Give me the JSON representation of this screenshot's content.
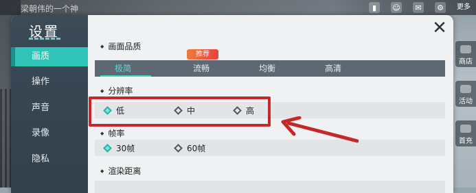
{
  "top_bar": {
    "title": "梁朝伟的一个神",
    "icons": [
      "chart-icon",
      "friends-icon",
      "mail-icon",
      "gear-icon"
    ],
    "more_label": "更多"
  },
  "right_menu": [
    "商店",
    "活动",
    "首充"
  ],
  "panel": {
    "title": "设置",
    "close_glyph": "✕",
    "sidebar": [
      {
        "label": "画质",
        "active": true
      },
      {
        "label": "操作",
        "active": false
      },
      {
        "label": "声音",
        "active": false
      },
      {
        "label": "录像",
        "active": false
      },
      {
        "label": "隐私",
        "active": false
      }
    ],
    "sections": {
      "quality": {
        "title": "画面品质",
        "badge": "推荐",
        "options": [
          {
            "label": "极简",
            "selected": true
          },
          {
            "label": "流畅",
            "selected": false
          },
          {
            "label": "均衡",
            "selected": false
          },
          {
            "label": "高清",
            "selected": false
          }
        ]
      },
      "resolution": {
        "title": "分辨率",
        "options": [
          {
            "label": "低",
            "selected": true
          },
          {
            "label": "中",
            "selected": false
          },
          {
            "label": "高",
            "selected": false
          }
        ]
      },
      "framerate": {
        "title": "帧率",
        "options": [
          {
            "label": "30帧",
            "selected": true
          },
          {
            "label": "60帧",
            "selected": false
          }
        ]
      },
      "render_distance": {
        "title": "渲染距离"
      }
    }
  },
  "colors": {
    "accent": "#2fc4b7",
    "highlight": "#c62827",
    "sidebar": "#3c4a57"
  }
}
